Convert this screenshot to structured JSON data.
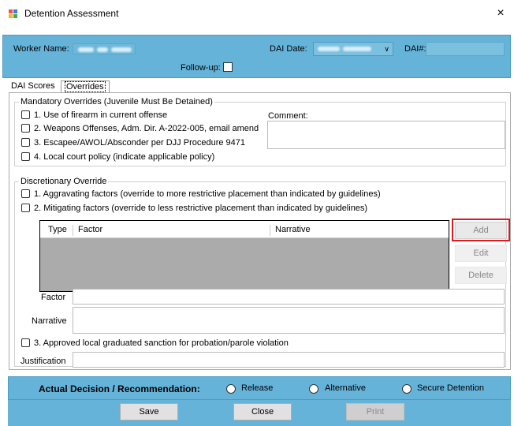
{
  "window": {
    "title": "Detention Assessment",
    "close_glyph": "×",
    "icon": "app-window-icon"
  },
  "header": {
    "worker_name_label": "Worker Name:",
    "dai_date_label": "DAI Date:",
    "dai_number_label": "DAI#:",
    "follow_up_label": "Follow-up:",
    "follow_up_checked": false
  },
  "tabs": [
    {
      "label": "DAI Scores"
    },
    {
      "label": "Overrides",
      "selected": true
    }
  ],
  "mandatory": {
    "title": "Mandatory Overrides (Juvenile Must Be Detained)",
    "items": [
      "1. Use of firearm in current offense",
      "2. Weapons Offenses, Adm. Dir. A-2022-005, email amend",
      "3. Escapee/AWOL/Absconder per DJJ Procedure 9471",
      "4. Local court policy (indicate applicable policy)"
    ],
    "comment_label": "Comment:"
  },
  "discretionary": {
    "title": "Discretionary Override",
    "items": [
      "1. Aggravating factors (override to more restrictive placement than indicated by guidelines)",
      "2. Mitigating factors (override to less restrictive placement than indicated by guidelines)"
    ],
    "grid_columns": [
      "Type",
      "Factor",
      "Narrative"
    ],
    "buttons": {
      "add": "Add",
      "edit": "Edit",
      "delete": "Delete"
    },
    "factor_label": "Factor",
    "narrative_label": "Narrative",
    "sanction_item": "3. Approved local graduated sanction for probation/parole violation",
    "justification_label": "Justification"
  },
  "decision": {
    "label": "Actual Decision / Recommendation:",
    "options": [
      "Release",
      "Alternative",
      "Secure Detention"
    ]
  },
  "footer": {
    "save": "Save",
    "close": "Close",
    "print": "Print"
  },
  "colors": {
    "band": "#66b3d9",
    "highlight": "#e0191e"
  }
}
